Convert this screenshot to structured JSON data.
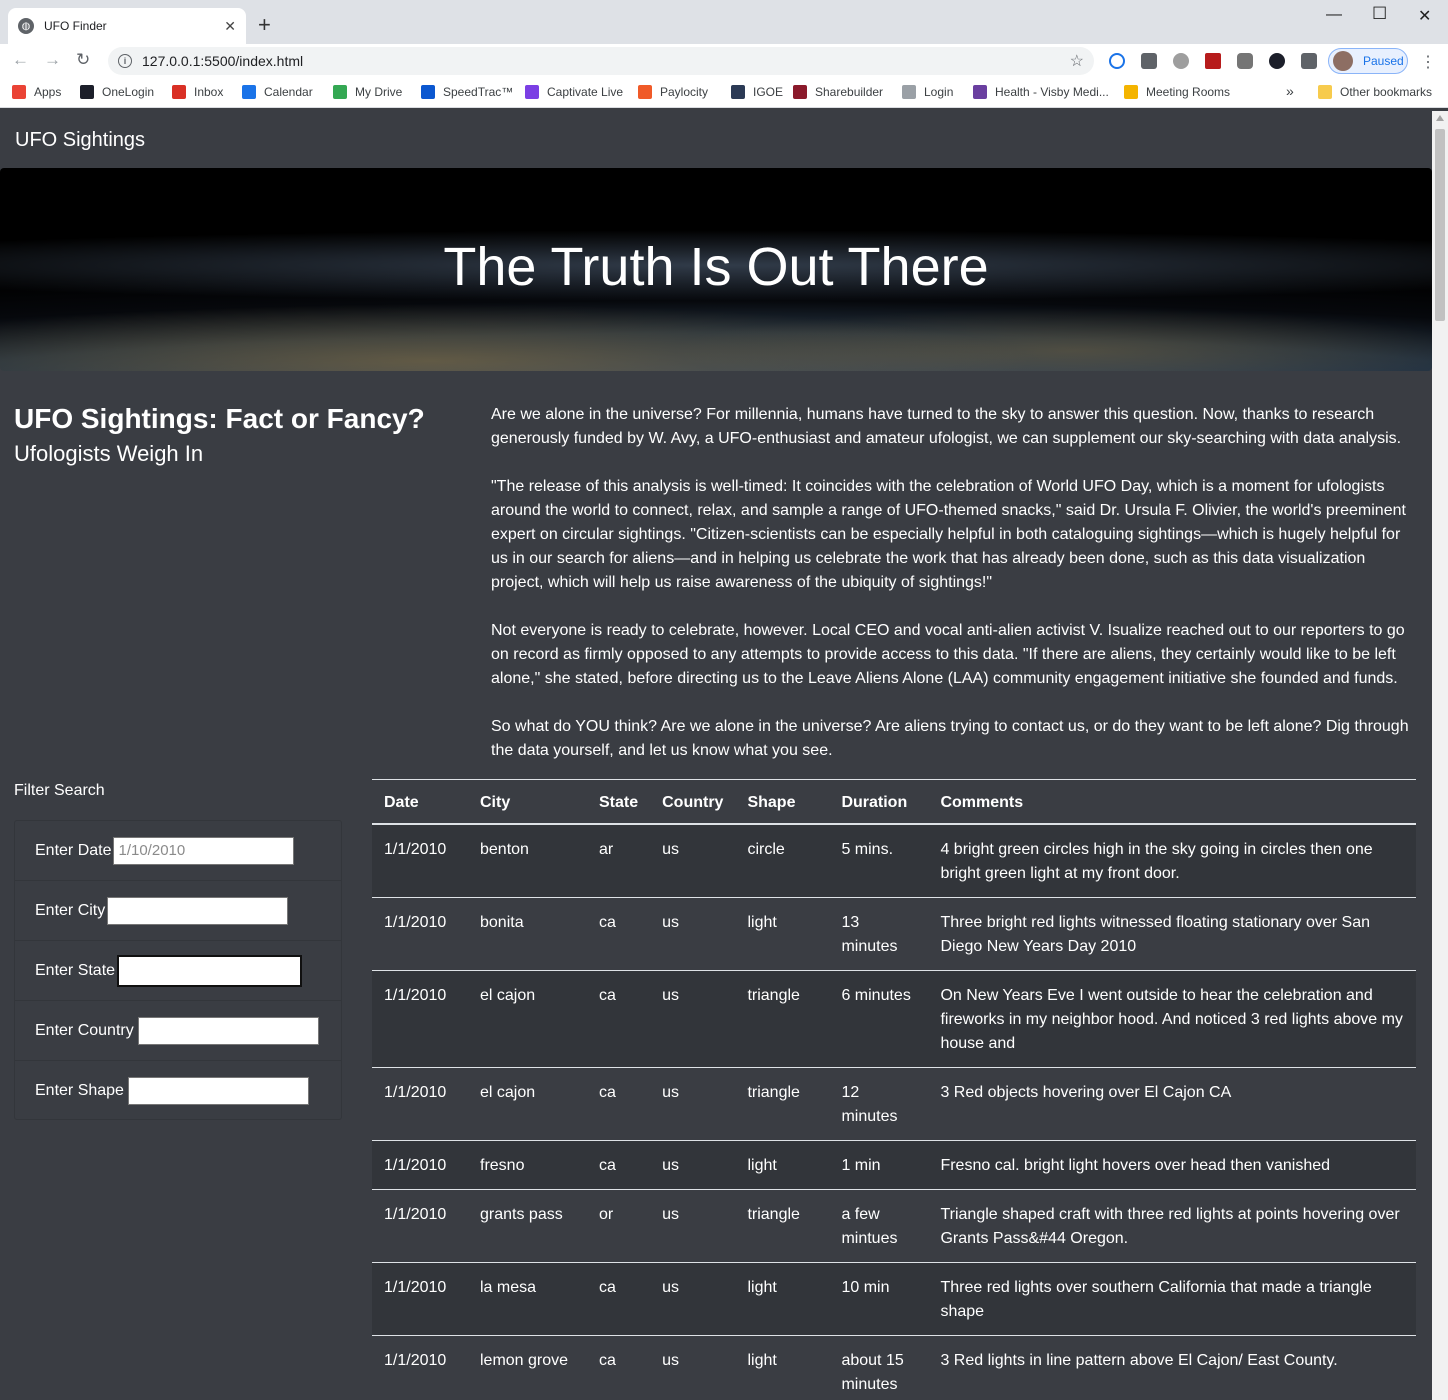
{
  "browser": {
    "tab_title": "UFO Finder",
    "tab_close": "✕",
    "new_tab": "+",
    "url": "127.0.0.1:5500/index.html",
    "profile_status": "Paused",
    "bookmarks": [
      {
        "label": "Apps",
        "icon": "apps-grid-icon",
        "color": "#ea4335"
      },
      {
        "label": "OneLogin",
        "icon": "onelogin-icon",
        "color": "#1c1f2a"
      },
      {
        "label": "Inbox",
        "icon": "gmail-icon",
        "color": "#d93025"
      },
      {
        "label": "Calendar",
        "icon": "calendar-icon",
        "color": "#1a73e8"
      },
      {
        "label": "My Drive",
        "icon": "drive-icon",
        "color": "#34a853"
      },
      {
        "label": "SpeedTrac™",
        "icon": "speedtrac-icon",
        "color": "#0b57d0"
      },
      {
        "label": "Captivate Live",
        "icon": "captivate-icon",
        "color": "#7b3fe4"
      },
      {
        "label": "Paylocity",
        "icon": "paylocity-icon",
        "color": "#f05a28"
      },
      {
        "label": "IGOE",
        "icon": "igoe-icon",
        "color": "#2b3a55"
      },
      {
        "label": "Sharebuilder",
        "icon": "sharebuilder-icon",
        "color": "#8b1a2b"
      },
      {
        "label": "Login",
        "icon": "google-icon",
        "color": "#9aa0a6"
      },
      {
        "label": "Health - Visby Medi...",
        "icon": "visby-icon",
        "color": "#6a3fa0"
      },
      {
        "label": "Meeting Rooms",
        "icon": "meeting-rooms-icon",
        "color": "#f4b400"
      }
    ],
    "more_bookmarks": "»",
    "other_bookmarks": "Other bookmarks"
  },
  "site": {
    "brand": "UFO Sightings",
    "hero_title": "The Truth Is Out There",
    "heading": "UFO Sightings: Fact or Fancy?",
    "subheading": "Ufologists Weigh In",
    "paragraphs": [
      "Are we alone in the universe? For millennia, humans have turned to the sky to answer this question. Now, thanks to research generously funded by W. Avy, a UFO-enthusiast and amateur ufologist, we can supplement our sky-searching with data analysis.",
      "\"The release of this analysis is well-timed: It coincides with the celebration of World UFO Day, which is a moment for ufologists around the world to connect, relax, and sample a range of UFO-themed snacks,\" said Dr. Ursula F. Olivier, the world's preeminent expert on circular sightings. \"Citizen-scientists can be especially helpful in both cataloguing sightings—which is hugely helpful for us in our search for aliens—and in helping us celebrate the work that has already been done, such as this data visualization project, which will help us raise awareness of the ubiquity of sightings!\"",
      "Not everyone is ready to celebrate, however. Local CEO and vocal anti-alien activist V. Isualize reached out to our reporters to go on record as firmly opposed to any attempts to provide access to this data. \"If there are aliens, they certainly would like to be left alone,\" she stated, before directing us to the Leave Aliens Alone (LAA) community engagement initiative she founded and funds.",
      "So what do YOU think? Are we alone in the universe? Are aliens trying to contact us, or do they want to be left alone? Dig through the data yourself, and let us know what you see."
    ]
  },
  "filters": {
    "title": "Filter Search",
    "date": {
      "label": "Enter Date",
      "placeholder": "1/10/2010",
      "value": ""
    },
    "city": {
      "label": "Enter City",
      "placeholder": "",
      "value": ""
    },
    "state": {
      "label": "Enter State",
      "placeholder": "",
      "value": ""
    },
    "country": {
      "label": "Enter Country",
      "placeholder": "",
      "value": ""
    },
    "shape": {
      "label": "Enter Shape",
      "placeholder": "",
      "value": ""
    }
  },
  "table": {
    "headers": [
      "Date",
      "City",
      "State",
      "Country",
      "Shape",
      "Duration",
      "Comments"
    ],
    "rows": [
      [
        "1/1/2010",
        "benton",
        "ar",
        "us",
        "circle",
        "5 mins.",
        "4 bright green circles high in the sky going in circles then one bright green light at my front door."
      ],
      [
        "1/1/2010",
        "bonita",
        "ca",
        "us",
        "light",
        "13 minutes",
        "Three bright red lights witnessed floating stationary over San Diego New Years Day 2010"
      ],
      [
        "1/1/2010",
        "el cajon",
        "ca",
        "us",
        "triangle",
        "6 minutes",
        "On New Years Eve I went outside to hear the celebration and fireworks in my neighbor hood. And noticed 3 red lights above my house and"
      ],
      [
        "1/1/2010",
        "el cajon",
        "ca",
        "us",
        "triangle",
        "12 minutes",
        "3 Red objects hovering over El Cajon CA"
      ],
      [
        "1/1/2010",
        "fresno",
        "ca",
        "us",
        "light",
        "1 min",
        "Fresno cal. bright light hovers over head then vanished"
      ],
      [
        "1/1/2010",
        "grants pass",
        "or",
        "us",
        "triangle",
        "a few mintues",
        "Triangle shaped craft with three red lights at points hovering over Grants Pass&#44 Oregon."
      ],
      [
        "1/1/2010",
        "la mesa",
        "ca",
        "us",
        "light",
        "10 min",
        "Three red lights over southern California that made a triangle shape"
      ],
      [
        "1/1/2010",
        "lemon grove",
        "ca",
        "us",
        "light",
        "about 15 minutes",
        "3 Red lights in line pattern above El Cajon/ East County."
      ]
    ]
  }
}
